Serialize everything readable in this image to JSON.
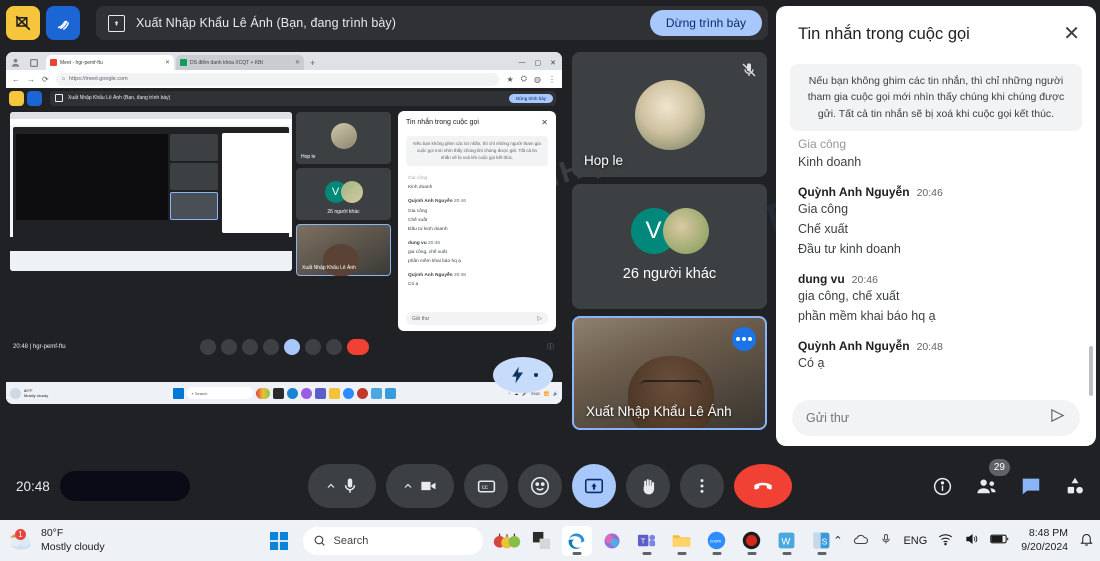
{
  "topbar": {
    "annotate_disabled_icon": "annotate-off-icon",
    "draw_icon": "pen-squiggle-icon",
    "present_icon": "present-screen-icon",
    "present_label": "Xuất Nhập Khẩu Lê Ánh (Bạn, đang trình bày)",
    "stop_present_label": "Dừng trình bày"
  },
  "shared_screen": {
    "tabs": [
      {
        "title": "Meet - hgr-pemf-ftu",
        "active": true
      },
      {
        "title": "DS điểm danh khóa XCQT + KBt",
        "active": false
      }
    ],
    "new_tab_label": "+",
    "url": "https://meet.google.com",
    "inner": {
      "present_label": "Xuất Nhập Khẩu Lê Ánh (Bạn, đang trình bày)",
      "stop_present_label": "Dừng trình bày",
      "chat_title": "Tin nhắn trong cuộc gọi",
      "chat_notice": "Nếu bạn không ghim các tin nhắn, thì chỉ những người tham gia cuộc gọi mới nhìn thấy chúng khi chúng được gửi. Tất cả tin nhắn sẽ bị xoá khi cuộc gọi kết thúc.",
      "tiles": [
        {
          "name": "Hop le"
        },
        {
          "name": "26 người khác"
        },
        {
          "name": "Xuất Nhập Khẩu Lê Ánh"
        }
      ],
      "status_time": "20:48",
      "status_code": "hgr-pemf-ftu"
    }
  },
  "tiles": [
    {
      "name": "Hop le",
      "muted": true,
      "type": "avatar"
    },
    {
      "name": "26 người khác",
      "type": "overflow",
      "initial": "V"
    },
    {
      "name": "Xuất Nhập Khẩu Lê Ánh",
      "type": "self",
      "badge": "more-options-icon"
    }
  ],
  "chat": {
    "title": "Tin nhắn trong cuộc gọi",
    "close_icon": "close-icon",
    "notice": "Nếu bạn không ghim các tin nhắn, thì chỉ những người tham gia cuộc gọi mới nhìn thấy chúng khi chúng được gửi. Tất cả tin nhắn sẽ bị xoá khi cuộc gọi kết thúc.",
    "clipped_lines": [
      "Gia công",
      "Kinh doanh"
    ],
    "messages": [
      {
        "author": "Quỳnh Anh Nguyễn",
        "time": "20:46",
        "lines": [
          "Gia công",
          "Chế xuất",
          "Đầu tư kinh doanh"
        ]
      },
      {
        "author": "dung vu",
        "time": "20:46",
        "lines": [
          "gia công, chế xuất",
          "phần mềm khai báo hq ạ"
        ]
      },
      {
        "author": "Quỳnh Anh Nguyễn",
        "time": "20:48",
        "lines": [
          "Có ạ"
        ]
      }
    ],
    "input_placeholder": "Gửi thư",
    "send_icon": "send-icon"
  },
  "controls": {
    "time": "20:48",
    "buttons": [
      {
        "name": "microphone",
        "icon": "microphone-icon",
        "has_chevron": true
      },
      {
        "name": "camera",
        "icon": "video-camera-icon",
        "has_chevron": true
      },
      {
        "name": "captions",
        "icon": "closed-captions-icon"
      },
      {
        "name": "reactions",
        "icon": "emoji-smile-icon"
      },
      {
        "name": "present",
        "icon": "present-screen-icon",
        "active": true
      },
      {
        "name": "raise-hand",
        "icon": "raised-hand-icon"
      },
      {
        "name": "more-options",
        "icon": "three-dots-vertical-icon"
      },
      {
        "name": "leave-call",
        "icon": "phone-hangup-icon"
      }
    ],
    "right_icons": [
      {
        "name": "meeting-details",
        "icon": "info-circle-icon"
      },
      {
        "name": "people",
        "icon": "people-icon",
        "badge": "29"
      },
      {
        "name": "chat",
        "icon": "chat-bubble-icon",
        "active": true
      },
      {
        "name": "activities",
        "icon": "activities-shapes-icon"
      }
    ]
  },
  "taskbar": {
    "weather": {
      "temp": "80°F",
      "condition": "Mostly cloudy"
    },
    "start_icon": "windows-start-icon",
    "search_placeholder": "Search",
    "search_icon": "search-icon",
    "apps": [
      {
        "name": "widgets-fruit",
        "icon": "fruit-widget-icon",
        "running": false
      },
      {
        "name": "file-explorer-alt",
        "icon": "explorer-dark-icon",
        "running": false
      },
      {
        "name": "microsoft-edge",
        "icon": "edge-icon",
        "running": true,
        "selected": true
      },
      {
        "name": "copilot",
        "icon": "copilot-icon",
        "running": false
      },
      {
        "name": "microsoft-teams",
        "icon": "teams-icon",
        "running": true
      },
      {
        "name": "file-explorer",
        "icon": "folder-icon",
        "running": true
      },
      {
        "name": "zoom",
        "icon": "zoom-icon",
        "running": true
      },
      {
        "name": "screen-recorder",
        "icon": "record-icon",
        "running": true
      },
      {
        "name": "wps-writer",
        "icon": "wps-w-icon",
        "running": true
      },
      {
        "name": "wps-spreadsheet",
        "icon": "wps-s-icon",
        "running": true
      }
    ],
    "tray": [
      {
        "name": "show-hidden-icons",
        "icon": "chevron-up-icon"
      },
      {
        "name": "onedrive",
        "icon": "cloud-icon"
      },
      {
        "name": "microphone-status",
        "icon": "microphone-icon"
      },
      {
        "name": "language",
        "icon": "ENG"
      },
      {
        "name": "wifi",
        "icon": "wifi-icon"
      },
      {
        "name": "volume",
        "icon": "speaker-icon"
      },
      {
        "name": "battery",
        "icon": "battery-icon"
      }
    ],
    "clock": {
      "time": "8:48 PM",
      "date": "9/20/2024"
    },
    "notifications_icon": "bell-icon"
  },
  "watermarks": {
    "main": "XUẤT NHẬP KHẨU",
    "secondary": "TĂNG T"
  }
}
